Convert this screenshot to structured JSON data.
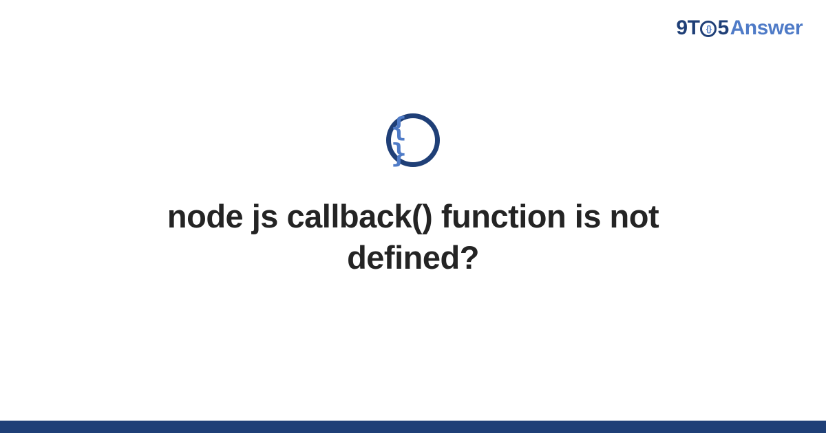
{
  "brand": {
    "part1": "9T",
    "o_inner": "{}",
    "part2": "5",
    "part3": "Answer"
  },
  "icon": {
    "glyph": "{ }"
  },
  "title": "node js callback() function is not defined?",
  "colors": {
    "dark": "#1f3f77",
    "light": "#4f7bc7"
  }
}
